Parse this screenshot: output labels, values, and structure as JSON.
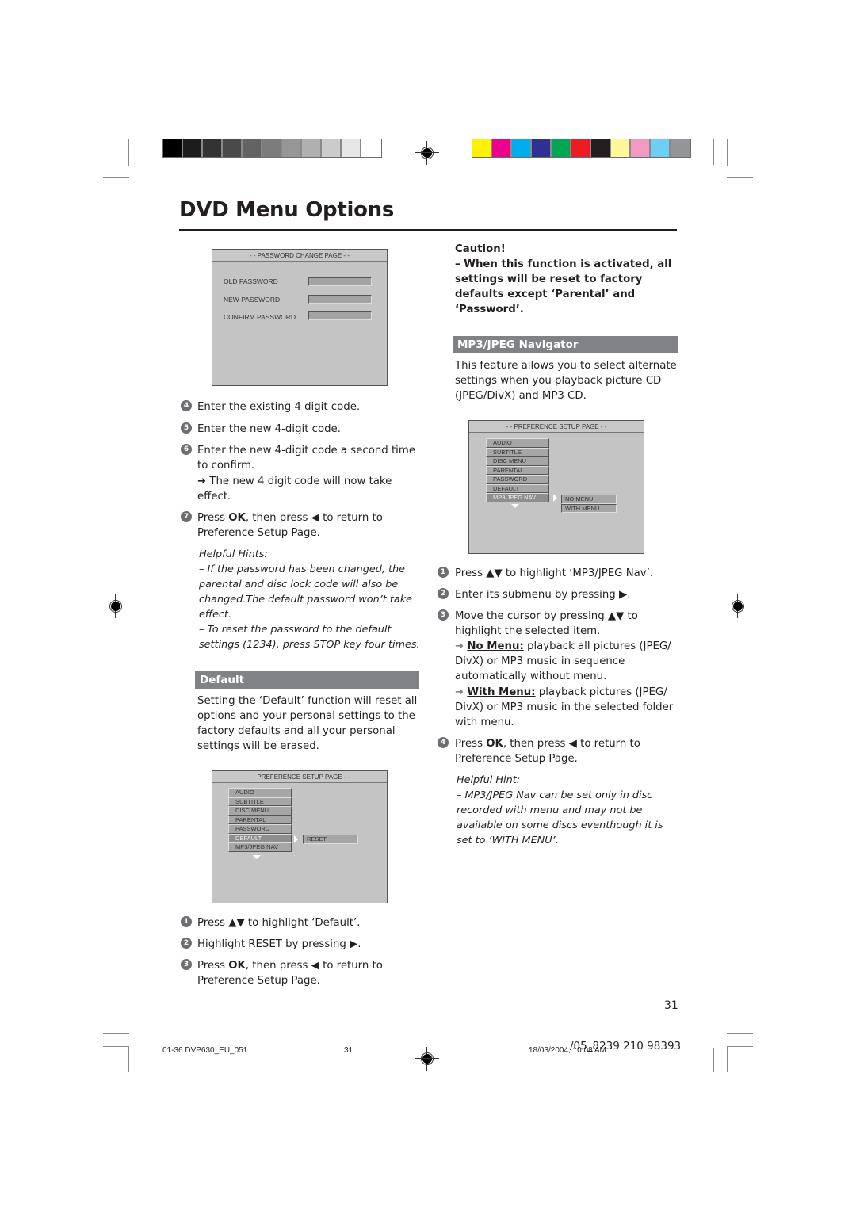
{
  "color_bars": {
    "grayscale": [
      "#000000",
      "#1c1c1c",
      "#333333",
      "#4a4a4a",
      "#636363",
      "#7c7c7c",
      "#969696",
      "#b0b0b0",
      "#cbcbcb",
      "#e6e6e6",
      "#ffffff"
    ],
    "process": [
      "#fff200",
      "#ec008c",
      "#00aeef",
      "#2e3192",
      "#00a651",
      "#ed1c24",
      "#231f20",
      "#fff799",
      "#f49ac1",
      "#6dcff6",
      "#939598"
    ]
  },
  "header": {
    "title": "DVD Menu Options"
  },
  "password_screen": {
    "header": "- - PASSWORD CHANGE PAGE - -",
    "fields": [
      {
        "label": "OLD PASSWORD",
        "value": ""
      },
      {
        "label": "NEW PASSWORD",
        "value": ""
      },
      {
        "label": "CONFIRM PASSWORD",
        "value": ""
      }
    ]
  },
  "password_steps": [
    {
      "num": "4",
      "text": "Enter the existing 4 digit code."
    },
    {
      "num": "5",
      "text": "Enter the new 4-digit code."
    },
    {
      "num": "6",
      "text": "Enter the new 4-digit code a second time to confirm.",
      "result": "➜ The new 4 digit code will now take effect."
    },
    {
      "num": "7",
      "pre": "Press ",
      "bold": "OK",
      "post": ", then press ◀ to return to Preference Setup Page."
    }
  ],
  "password_hints": {
    "title": "Helpful Hints:",
    "items": [
      "–    If the password has been changed, the parental and disc lock code will also be changed.The default password won’t take effect.",
      "–    To reset the password to the default settings (1234), press STOP key four times."
    ],
    "stop_key": "STOP"
  },
  "default_section": {
    "heading": "Default",
    "description": "Setting the ‘Default’ function will reset all options and your personal settings to the factory defaults and all your personal settings will be erased."
  },
  "default_screen": {
    "header": "- - PREFERENCE SETUP PAGE - -",
    "menu": [
      "AUDIO",
      "SUBTITLE",
      "DISC MENU",
      "PARENTAL",
      "PASSWORD",
      "DEFAULT",
      "MP3/JPEG NAV"
    ],
    "selected": "DEFAULT",
    "submenu": [
      "RESET"
    ]
  },
  "default_steps": [
    {
      "num": "1",
      "text": "Press ▲▼ to highlight ‘Default’."
    },
    {
      "num": "2",
      "text": "Highlight RESET by pressing ▶."
    },
    {
      "num": "3",
      "pre": "Press ",
      "bold": "OK",
      "post": ", then press ◀ to return to Preference Setup Page."
    }
  ],
  "caution": {
    "title": "Caution!",
    "text": "–  When this function is activated, all settings will be reset to factory defaults except ‘Parental’ and ‘Password’."
  },
  "mp3_section": {
    "heading": "MP3/JPEG Navigator",
    "description": "This feature allows you to select alternate settings when you playback picture CD (JPEG/DivX) and MP3 CD."
  },
  "mp3_screen": {
    "header": "- - PREFERENCE SETUP PAGE - -",
    "menu": [
      "AUDIO",
      "SUBTITLE",
      "DISC MENU",
      "PARENTAL",
      "PASSWORD",
      "DEFAULT",
      "MP3/JPEG NAV"
    ],
    "selected": "MP3/JPEG NAV",
    "submenu": [
      "NO MENU",
      "WITH MENU"
    ]
  },
  "mp3_steps": [
    {
      "num": "1",
      "text": "Press ▲▼ to highlight ‘MP3/JPEG Nav’."
    },
    {
      "num": "2",
      "text": "Enter its submenu by pressing ▶."
    },
    {
      "num": "3",
      "text": "Move the cursor by pressing ▲▼ to highlight the selected item.",
      "options": [
        {
          "label": "No Menu:",
          "text": "playback all pictures (JPEG/ DivX) or MP3 music in sequence automatically without menu."
        },
        {
          "label": "With Menu:",
          "text": "playback pictures (JPEG/ DivX) or MP3 music in the selected folder with menu."
        }
      ]
    },
    {
      "num": "4",
      "pre": "Press ",
      "bold": "OK",
      "post": ", then press ◀ to return to Preference Setup Page."
    }
  ],
  "mp3_hint": {
    "title": "Helpful Hint:",
    "text": "–    MP3/JPEG Nav can be set only in disc recorded with menu and may not be available on some discs eventhough it is set to ‘WITH MENU’."
  },
  "footer": {
    "page_number": "31",
    "file_name": "01-36 DVP630_EU_051",
    "slug_page": "31",
    "date": "18/03/2004, 10:08 AM",
    "code": "/05_8239 210 98393"
  }
}
